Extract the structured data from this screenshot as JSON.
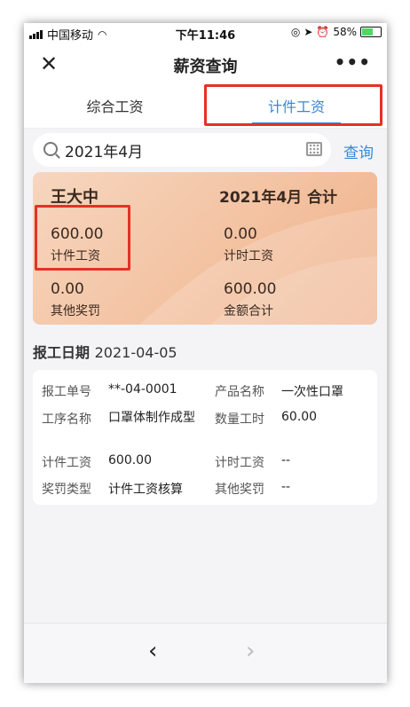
{
  "status_bar": {
    "carrier": "中国移动",
    "time": "下午11:46",
    "battery_text": "58%"
  },
  "header": {
    "title": "薪资查询",
    "close_icon": "close-icon",
    "more_icon": "more-icon"
  },
  "tabs": [
    {
      "label": "综合工资",
      "active": false
    },
    {
      "label": "计件工资",
      "active": true
    }
  ],
  "search": {
    "value": "2021年4月",
    "button_label": "查询"
  },
  "summary": {
    "name": "王大中",
    "period": "2021年4月 合计",
    "items": [
      {
        "value": "600.00",
        "label": "计件工资"
      },
      {
        "value": "0.00",
        "label": "计时工资"
      },
      {
        "value": "0.00",
        "label": "其他奖罚"
      },
      {
        "value": "600.00",
        "label": "金额合计"
      }
    ]
  },
  "section": {
    "title": "报工日期",
    "date": "2021-04-05"
  },
  "record": {
    "rows": [
      [
        {
          "label": "报工单号",
          "value": "**-04-0001"
        },
        {
          "label": "产品名称",
          "value": "一次性口罩"
        }
      ],
      [
        {
          "label": "工序名称",
          "value": "口罩体制作成型"
        },
        {
          "label": "数量工时",
          "value": "60.00"
        }
      ],
      [
        {
          "label": "计件工资",
          "value": "600.00"
        },
        {
          "label": "计时工资",
          "value": "--"
        }
      ],
      [
        {
          "label": "奖罚类型",
          "value": "计件工资核算"
        },
        {
          "label": "其他奖罚",
          "value": "--"
        }
      ]
    ]
  },
  "colors": {
    "accent": "#3a86d9",
    "highlight_box": "#e23225",
    "card_gradient_start": "#f7d6bf",
    "card_gradient_end": "#efb08a"
  }
}
